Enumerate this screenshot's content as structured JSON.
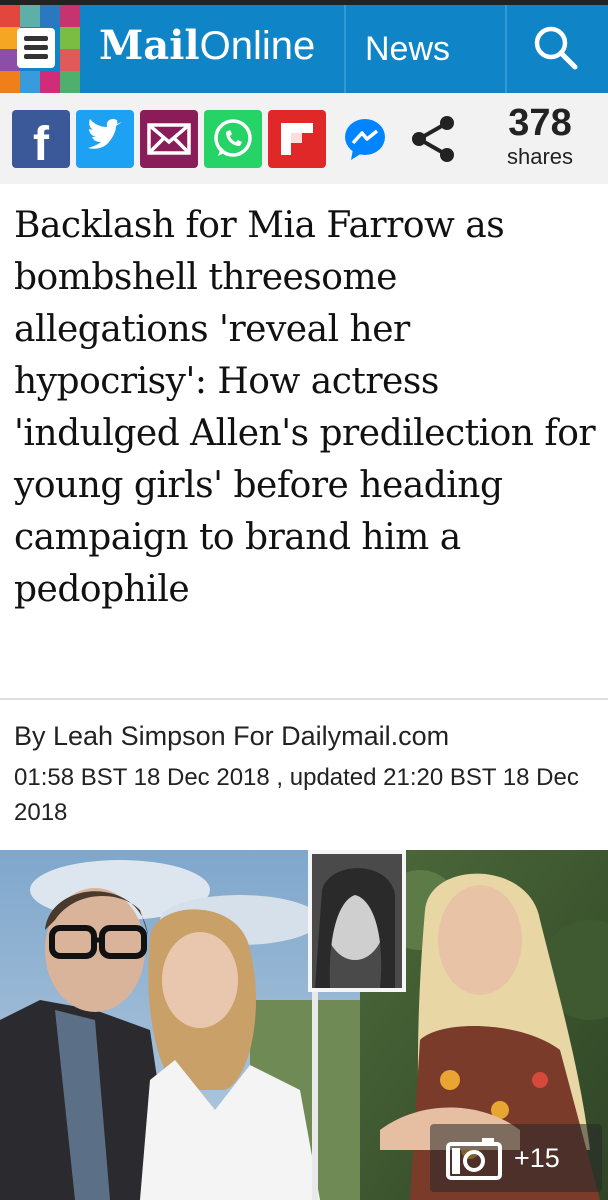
{
  "header": {
    "brand_mail": "Mail",
    "brand_online": "Online",
    "section": "News",
    "icons": [
      "menu-icon",
      "search-icon"
    ],
    "background_color": "#0f85c7"
  },
  "share_bar": {
    "buttons": [
      {
        "icon": "facebook-icon",
        "color": "#3b5998"
      },
      {
        "icon": "twitter-icon",
        "color": "#1da1f2"
      },
      {
        "icon": "email-icon",
        "color": "#8a1c5a"
      },
      {
        "icon": "whatsapp-icon",
        "color": "#25d366"
      },
      {
        "icon": "flipboard-icon",
        "color": "#e12828"
      },
      {
        "icon": "messenger-icon",
        "color": "#0084ff"
      },
      {
        "icon": "share-icon",
        "color": "#222222"
      }
    ],
    "count": "378",
    "count_label": "shares"
  },
  "article": {
    "headline": "Backlash for Mia Farrow as bombshell threesome allegations 'reveal her hypocrisy': How actress 'indulged Allen's predilection for young girls' before heading campaign to brand him a pedophile",
    "byline": "By Leah Simpson For Dailymail.com",
    "dateline": "01:58 BST 18 Dec 2018 , updated 21:20 BST 18 Dec 2018"
  },
  "gallery": {
    "icon": "camera-icon",
    "count": "+15"
  }
}
